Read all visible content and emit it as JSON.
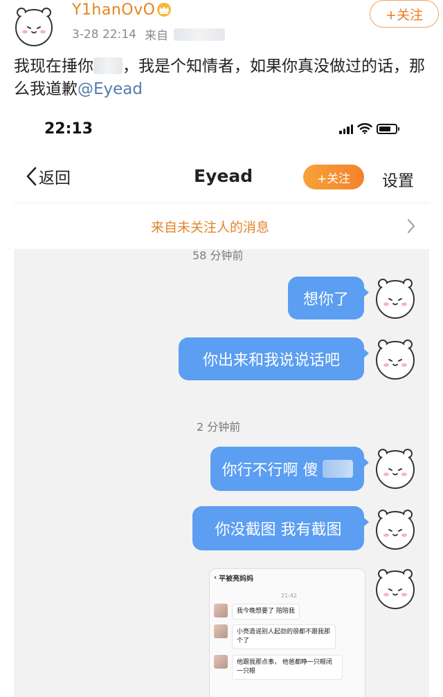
{
  "post": {
    "username": "Y1hanOvO",
    "timestamp": "3-28 22:14",
    "source_prefix": "来自",
    "follow_label": "+关注",
    "text_before_blur": "我现在捶你",
    "text_after_blur": "，我是个知情者，如果你真没做过的话，那么我道歉",
    "mention": "@Eyead"
  },
  "phone": {
    "status_time": "22:13",
    "nav": {
      "back_label": "返回",
      "title": "Eyead",
      "follow_label": "+关注",
      "settings_label": "设置"
    },
    "from_bar_label": "来自未关注人的消息",
    "chat": {
      "timestamp_1": "58 分钟前",
      "timestamp_2": "2 分钟前",
      "messages": [
        "想你了",
        "你出来和我说说话吧",
        "你行不行啊 傻",
        "你没截图 我有截图"
      ],
      "image_message": {
        "header_name": "平被亮妈妈",
        "time": "21:42",
        "lines": [
          "我今晚想要了 陪陪我",
          "小亮造谣别人起劲的很都不跟我那个了",
          "他跟我那点事， 他爸都睁一只眼闭一只眼"
        ]
      }
    }
  },
  "colors": {
    "username": "#e8831c",
    "bubble": "#5b9ef2",
    "mention": "#507daf",
    "chat_bg": "#f2f2f2",
    "follow_orange": "#f3822c"
  }
}
